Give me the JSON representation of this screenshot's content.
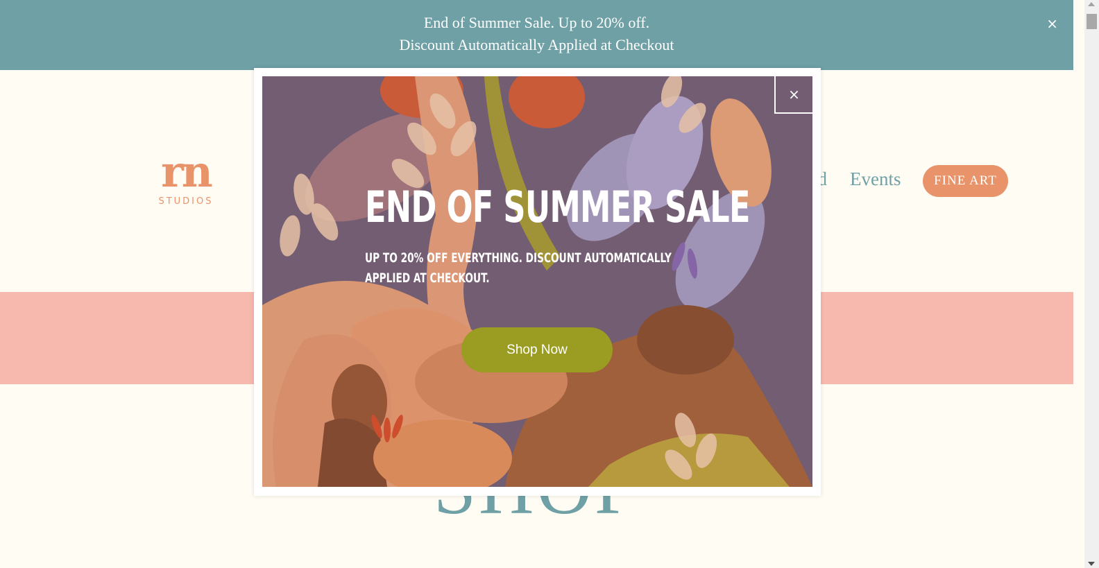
{
  "announcement": {
    "line1": "End of Summer Sale. Up to 20% off.",
    "line2": "Discount Automatically Applied at Checkout",
    "close": "×"
  },
  "header": {
    "logo_mark": "rn",
    "logo_sub": "STUDIOS",
    "nav_partial": "nd",
    "nav_events": "Events",
    "nav_fine_art": "FINE ART"
  },
  "page": {
    "shop_heading": "SHOP"
  },
  "modal": {
    "close": "×",
    "title": "END OF SUMMER SALE",
    "subtitle": "UP TO 20% OFF EVERYTHING. DISCOUNT AUTOMATICALLY APPLIED AT CHECKOUT.",
    "button": "Shop Now"
  },
  "colors": {
    "announcement_bg": "#6fa0a5",
    "page_bg": "#fffcf4",
    "accent_orange": "#e8936a",
    "band_pink": "#f7b8ae",
    "button_olive": "#9b9c22"
  }
}
